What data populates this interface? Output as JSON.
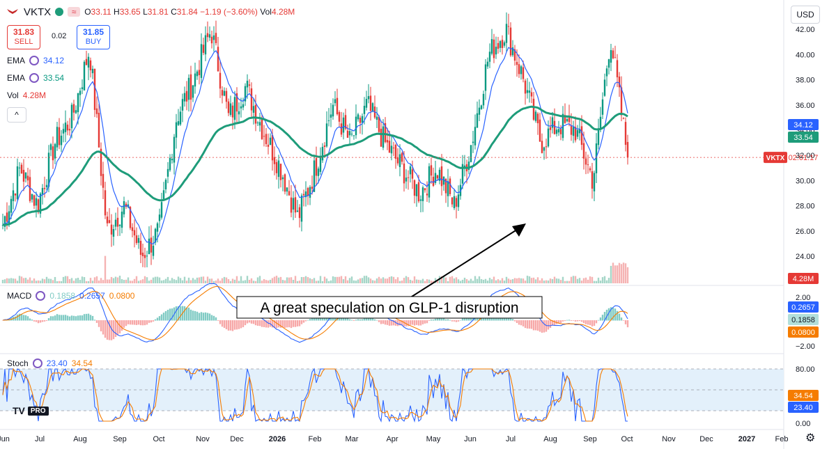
{
  "header": {
    "symbol": "VKTX",
    "open_label": "O",
    "open": "33.11",
    "high_label": "H",
    "high": "33.65",
    "low_label": "L",
    "low": "31.81",
    "close_label": "C",
    "close": "31.84",
    "change": "−1.19 (−3.60%)",
    "vol_label": "Vol",
    "vol": "4.28M"
  },
  "trade": {
    "sell_price": "31.83",
    "sell_label": "SELL",
    "spread": "0.02",
    "buy_price": "31.85",
    "buy_label": "BUY"
  },
  "indicators": {
    "ema1_label": "EMA",
    "ema1_value": "34.12",
    "ema2_label": "EMA",
    "ema2_value": "33.54",
    "vol_label": "Vol",
    "vol_value": "4.28M"
  },
  "macd_legend": {
    "label": "MACD",
    "v1": "0.1858",
    "v2": "0.2657",
    "v3": "0.0800"
  },
  "stoch_legend": {
    "label": "Stoch",
    "k": "23.40",
    "d": "34.54"
  },
  "currency": "USD",
  "brand": {
    "mark": "TV",
    "badge": "PRO"
  },
  "icons": {
    "settings": "gear-icon",
    "collapse": "chevron-up-icon",
    "logo": "viking-logo-icon"
  },
  "colors": {
    "up": "#089981",
    "down": "#e53935",
    "ema_fast": "#2962ff",
    "ema_slow": "#1e9c7a",
    "macd": "#2962ff",
    "signal": "#f57c00",
    "stoch_k": "#2962ff",
    "stoch_d": "#f57c00",
    "stoch_band": "#e3f0fb"
  },
  "chart_data": {
    "type": "candlestick",
    "annotation": "A great speculation on GLP-1 disruption",
    "x_tick_labels": [
      "Jun",
      "Jul",
      "Aug",
      "Sep",
      "Oct",
      "Nov",
      "Dec",
      "2026",
      "Feb",
      "Mar",
      "Apr",
      "May",
      "Jun",
      "Jul",
      "Aug",
      "Sep",
      "Oct",
      "Nov",
      "Dec",
      "2027",
      "Feb"
    ],
    "price_axis": {
      "ticks": [
        24,
        26,
        28,
        30,
        32,
        34,
        36,
        38,
        40,
        42
      ],
      "tick_labels": [
        "24.00",
        "26.00",
        "28.00",
        "30.00",
        "32.00",
        "34.00",
        "36.00",
        "38.00",
        "40.00",
        "42.00"
      ]
    },
    "price_marker": {
      "label": "VKTX",
      "countdown": "02:01:17",
      "value": 31.84
    },
    "ema_fast_last": "34.12",
    "ema_slow_last": "33.54",
    "volume_last": "4.28M",
    "macd_axis": {
      "ticks": [
        2,
        -2
      ],
      "tick_labels": [
        "2.00",
        "−2.00"
      ]
    },
    "macd_last": {
      "macd": "0.2657",
      "hist": "0.1858",
      "signal": "0.0800"
    },
    "stoch_axis": {
      "ticks": [
        0,
        80
      ],
      "tick_labels": [
        "0.00",
        "80.00"
      ]
    },
    "stoch_last": {
      "d": "34.54",
      "k": "23.40"
    },
    "price_path": [
      [
        "Jun",
        26.5
      ],
      [
        "Jun",
        31.0
      ],
      [
        "Jul",
        28.0
      ],
      [
        "Jul",
        33.0
      ],
      [
        "Aug",
        35.0
      ],
      [
        "Aug",
        40.5
      ],
      [
        "Aug",
        26.0
      ],
      [
        "Sep",
        28.0
      ],
      [
        "Sep",
        24.0
      ],
      [
        "Oct",
        26.0
      ],
      [
        "Oct",
        35.0
      ],
      [
        "Nov",
        38.0
      ],
      [
        "Nov",
        42.0
      ],
      [
        "Dec",
        35.0
      ],
      [
        "Dec",
        37.5
      ],
      [
        "2026",
        34.0
      ],
      [
        "2026",
        31.0
      ],
      [
        "Feb",
        27.0
      ],
      [
        "Feb",
        31.0
      ],
      [
        "Mar",
        36.0
      ],
      [
        "Mar",
        33.0
      ],
      [
        "Apr",
        36.0
      ],
      [
        "Apr",
        33.0
      ],
      [
        "May",
        31.0
      ],
      [
        "May",
        29.0
      ],
      [
        "Jun",
        31.0
      ],
      [
        "Jun",
        28.0
      ],
      [
        "Jun",
        33.0
      ],
      [
        "Jul",
        40.0
      ],
      [
        "Jul",
        42.0
      ],
      [
        "Jul",
        38.0
      ],
      [
        "Aug",
        33.0
      ],
      [
        "Aug",
        34.5
      ],
      [
        "Sep",
        34.0
      ],
      [
        "Sep",
        30.0
      ],
      [
        "Sep",
        41.5
      ],
      [
        "Sep",
        31.8
      ]
    ]
  }
}
